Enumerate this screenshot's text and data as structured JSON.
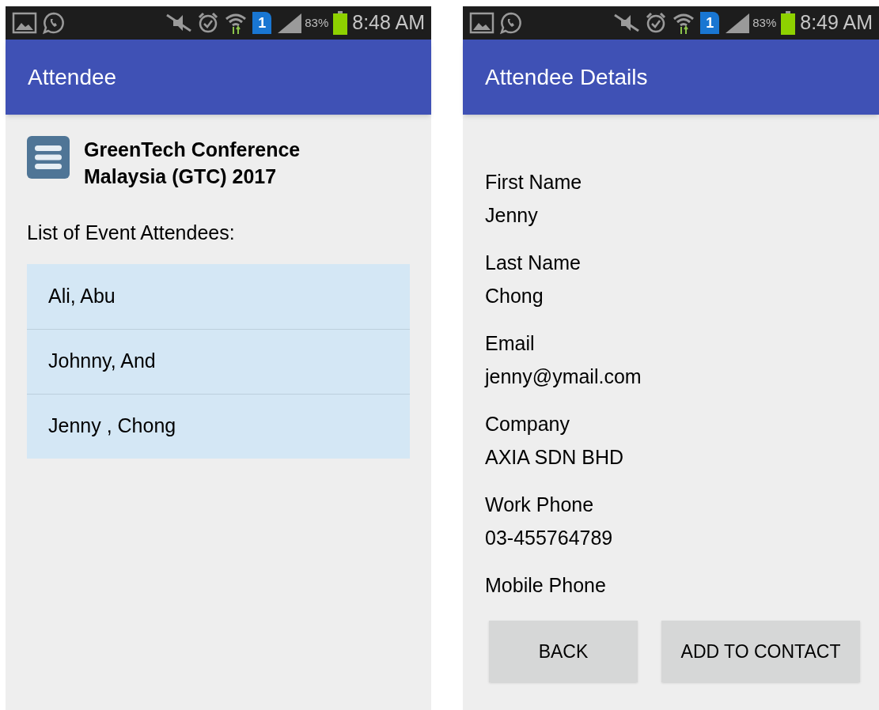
{
  "screens": [
    {
      "status_bar": {
        "sim_slot": "1",
        "battery": "83%",
        "time": "8:48 AM"
      },
      "app_bar": {
        "title": "Attendee"
      },
      "kind": "list",
      "event": {
        "title": "GreenTech Conference Malaysia (GTC) 2017"
      },
      "list_heading": "List of Event Attendees:",
      "attendees": [
        "Ali, Abu",
        "Johnny, And",
        "Jenny , Chong"
      ]
    },
    {
      "status_bar": {
        "sim_slot": "1",
        "battery": "83%",
        "time": "8:49 AM"
      },
      "app_bar": {
        "title": "Attendee Details"
      },
      "kind": "details",
      "fields": [
        {
          "label": "First Name",
          "value": "Jenny"
        },
        {
          "label": "Last Name",
          "value": "Chong"
        },
        {
          "label": "Email",
          "value": "jenny@ymail.com"
        },
        {
          "label": "Company",
          "value": "AXIA SDN BHD"
        },
        {
          "label": "Work Phone",
          "value": "03-455764789"
        },
        {
          "label": "Mobile Phone"
        }
      ],
      "buttons": [
        "BACK",
        "ADD TO CONTACT"
      ]
    }
  ]
}
